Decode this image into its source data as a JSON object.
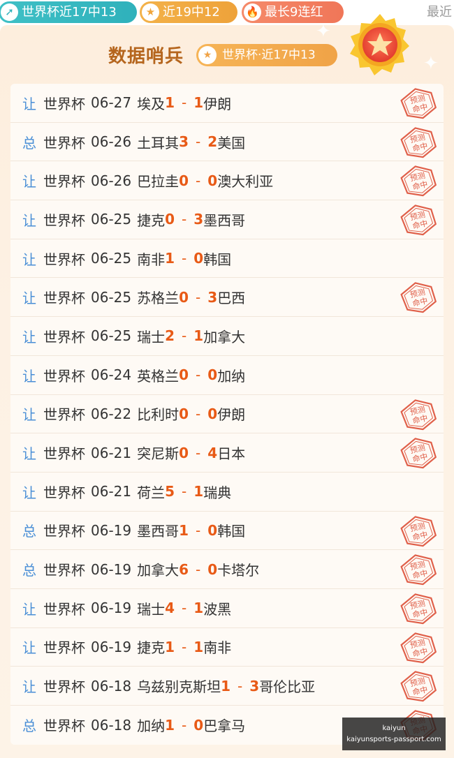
{
  "top_pills": {
    "worldcup_recent": "世界杯近17中13",
    "recent_19": "近19中12",
    "longest_streak": "最长9连红",
    "recent_label": "最近"
  },
  "header": {
    "title": "数据哨兵",
    "badge": "世界杯·近17中13"
  },
  "stamp_text": "预测命中",
  "records": [
    {
      "kind": "让",
      "comp": "世界杯",
      "date": "06-27",
      "home": "埃及",
      "hs": "1",
      "as": "1",
      "away": "伊朗",
      "hit": true
    },
    {
      "kind": "总",
      "comp": "世界杯",
      "date": "06-26",
      "home": "土耳其",
      "hs": "3",
      "as": "2",
      "away": "美国",
      "hit": true
    },
    {
      "kind": "让",
      "comp": "世界杯",
      "date": "06-26",
      "home": "巴拉圭",
      "hs": "0",
      "as": "0",
      "away": "澳大利亚",
      "hit": true
    },
    {
      "kind": "让",
      "comp": "世界杯",
      "date": "06-25",
      "home": "捷克",
      "hs": "0",
      "as": "3",
      "away": "墨西哥",
      "hit": true
    },
    {
      "kind": "让",
      "comp": "世界杯",
      "date": "06-25",
      "home": "南非",
      "hs": "1",
      "as": "0",
      "away": "韩国",
      "hit": false
    },
    {
      "kind": "让",
      "comp": "世界杯",
      "date": "06-25",
      "home": "苏格兰",
      "hs": "0",
      "as": "3",
      "away": "巴西",
      "hit": true
    },
    {
      "kind": "让",
      "comp": "世界杯",
      "date": "06-25",
      "home": "瑞士",
      "hs": "2",
      "as": "1",
      "away": "加拿大",
      "hit": false
    },
    {
      "kind": "让",
      "comp": "世界杯",
      "date": "06-24",
      "home": "英格兰",
      "hs": "0",
      "as": "0",
      "away": "加纳",
      "hit": false
    },
    {
      "kind": "让",
      "comp": "世界杯",
      "date": "06-22",
      "home": "比利时",
      "hs": "0",
      "as": "0",
      "away": "伊朗",
      "hit": true
    },
    {
      "kind": "让",
      "comp": "世界杯",
      "date": "06-21",
      "home": "突尼斯",
      "hs": "0",
      "as": "4",
      "away": "日本",
      "hit": true
    },
    {
      "kind": "让",
      "comp": "世界杯",
      "date": "06-21",
      "home": "荷兰",
      "hs": "5",
      "as": "1",
      "away": "瑞典",
      "hit": false
    },
    {
      "kind": "总",
      "comp": "世界杯",
      "date": "06-19",
      "home": "墨西哥",
      "hs": "1",
      "as": "0",
      "away": "韩国",
      "hit": true
    },
    {
      "kind": "总",
      "comp": "世界杯",
      "date": "06-19",
      "home": "加拿大",
      "hs": "6",
      "as": "0",
      "away": "卡塔尔",
      "hit": true
    },
    {
      "kind": "让",
      "comp": "世界杯",
      "date": "06-19",
      "home": "瑞士",
      "hs": "4",
      "as": "1",
      "away": "波黑",
      "hit": true
    },
    {
      "kind": "让",
      "comp": "世界杯",
      "date": "06-19",
      "home": "捷克",
      "hs": "1",
      "as": "1",
      "away": "南非",
      "hit": true
    },
    {
      "kind": "让",
      "comp": "世界杯",
      "date": "06-18",
      "home": "乌兹别克斯坦",
      "hs": "1",
      "as": "3",
      "away": "哥伦比亚",
      "hit": true
    },
    {
      "kind": "总",
      "comp": "世界杯",
      "date": "06-18",
      "home": "加纳",
      "hs": "1",
      "as": "0",
      "away": "巴拿马",
      "hit": true
    }
  ],
  "watermark": {
    "line1": "kaiyun",
    "line2": "kaiyunsports-passport.com"
  },
  "colors": {
    "accent_orange": "#e85a16",
    "kind_blue": "#4a8fd6",
    "title_brown": "#b5651d",
    "stamp_red": "#e0604a"
  }
}
